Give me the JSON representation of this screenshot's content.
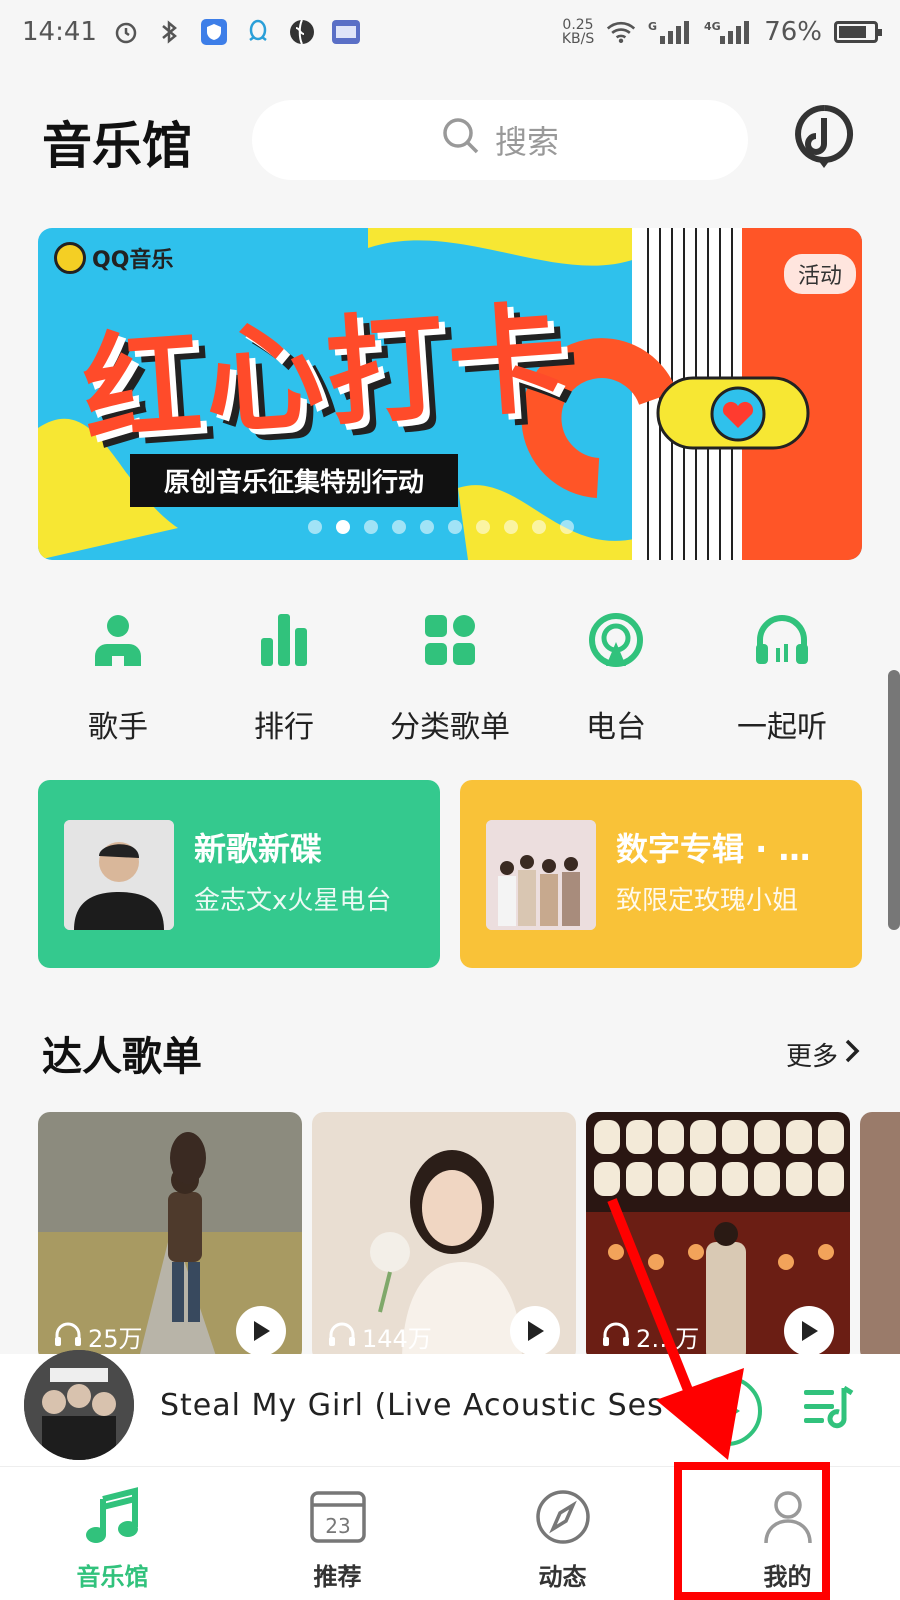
{
  "status_bar": {
    "time": "14:41",
    "net_speed_value": "0.25",
    "net_speed_unit": "KB/S",
    "net_g": "G",
    "net_4g": "4G",
    "battery": "76%"
  },
  "header": {
    "title": "音乐馆",
    "search_placeholder": "搜索"
  },
  "banner": {
    "logo": "QQ音乐",
    "title": "红心打卡",
    "subtitle": "原创音乐征集特别行动",
    "tag": "活动",
    "dot_count": 10,
    "active_dot": 1
  },
  "categories": [
    {
      "label": "歌手",
      "icon": "singer-icon"
    },
    {
      "label": "排行",
      "icon": "ranking-icon"
    },
    {
      "label": "分类歌单",
      "icon": "category-grid-icon"
    },
    {
      "label": "电台",
      "icon": "radio-icon"
    },
    {
      "label": "一起听",
      "icon": "headphones-icon"
    }
  ],
  "cards": [
    {
      "title": "新歌新碟",
      "subtitle": "金志文x火星电台"
    },
    {
      "title": "数字专辑 · …",
      "subtitle": "致限定玫瑰小姐"
    }
  ],
  "section": {
    "title": "达人歌单",
    "more": "更多"
  },
  "playlists": [
    {
      "count": "25万"
    },
    {
      "count": "144万"
    },
    {
      "count": "2…万"
    }
  ],
  "player": {
    "title": "Steal My Girl (Live Acoustic Ses"
  },
  "tabs": [
    {
      "label": "音乐馆",
      "icon": "music-note-icon",
      "active": true
    },
    {
      "label": "推荐",
      "icon": "calendar-icon",
      "badge": "23"
    },
    {
      "label": "动态",
      "icon": "compass-icon"
    },
    {
      "label": "我的",
      "icon": "person-icon"
    }
  ],
  "colors": {
    "accent": "#31c27c",
    "card_green": "#34c98e",
    "card_yellow": "#f9c238",
    "annotation_red": "#ff0000"
  }
}
